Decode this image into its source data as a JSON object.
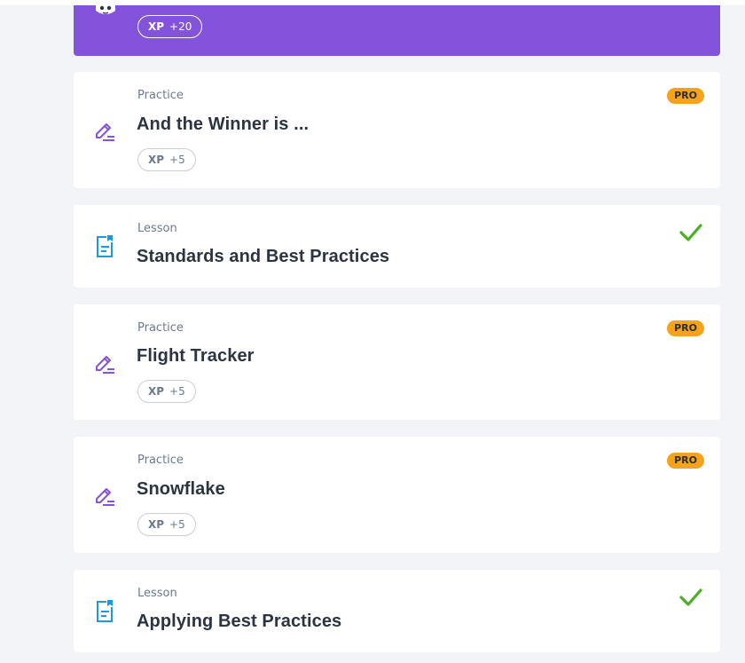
{
  "colors": {
    "accent_purple": "#8453db",
    "pro_badge": "#f5a31a",
    "check_green": "#4caf23",
    "lesson_blue": "#1a9ae0"
  },
  "top_card": {
    "xp_label": "XP",
    "xp_value": "+20",
    "icon": "mascot-icon"
  },
  "items": [
    {
      "kind": "Practice",
      "title": "And the Winner is ...",
      "xp_label": "XP",
      "xp_value": "+5",
      "badge": "PRO",
      "icon": "pencil-icon"
    },
    {
      "kind": "Lesson",
      "title": "Standards and Best Practices",
      "status": "completed",
      "icon": "document-icon"
    },
    {
      "kind": "Practice",
      "title": "Flight Tracker",
      "xp_label": "XP",
      "xp_value": "+5",
      "badge": "PRO",
      "icon": "pencil-icon"
    },
    {
      "kind": "Practice",
      "title": "Snowflake",
      "xp_label": "XP",
      "xp_value": "+5",
      "badge": "PRO",
      "icon": "pencil-icon"
    },
    {
      "kind": "Lesson",
      "title": "Applying Best Practices",
      "status": "completed",
      "icon": "document-icon"
    }
  ]
}
